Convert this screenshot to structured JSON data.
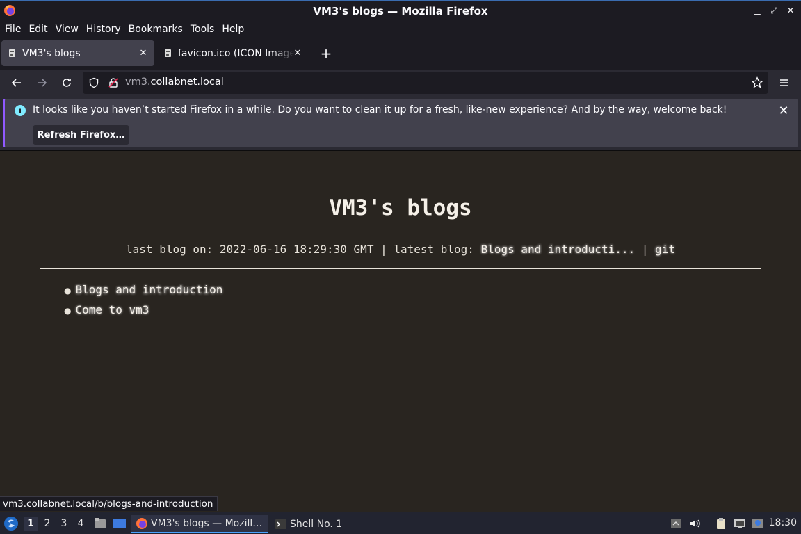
{
  "window": {
    "title": "VM3's blogs — Mozilla Firefox"
  },
  "menubar": {
    "items": [
      "File",
      "Edit",
      "View",
      "History",
      "Bookmarks",
      "Tools",
      "Help"
    ]
  },
  "tabs": [
    {
      "label": "VM3's blogs",
      "active": true
    },
    {
      "label": "favicon.ico (ICON Image,",
      "active": false
    }
  ],
  "urlbar": {
    "host_prefix": "vm3.",
    "host_rest": "collabnet.local"
  },
  "notification": {
    "message": "It looks like you haven’t started Firefox in a while. Do you want to clean it up for a fresh, like-new experience? And by the way, welcome back!",
    "button_label": "Refresh Firefox…"
  },
  "page": {
    "heading": "VM3's blogs",
    "meta_prefix": "last blog on: 2022-06-16 18:29:30 GMT | latest blog: ",
    "latest_blog_link": "Blogs and introducti...",
    "meta_separator": " | ",
    "git_link": "git",
    "posts": [
      "Blogs and introduction",
      "Come to vm3"
    ]
  },
  "status_link": "vm3.collabnet.local/b/blogs-and-introduction",
  "taskbar": {
    "workspaces": [
      "1",
      "2",
      "3",
      "4"
    ],
    "tasks": [
      "VM3's blogs — Mozill…",
      "Shell No. 1"
    ],
    "clock": "18:30"
  },
  "icons": {
    "app": "firefox-logo-icon",
    "tab_favicon": "favicon-icon",
    "back": "back-arrow-icon",
    "forward": "forward-arrow-icon",
    "reload": "reload-icon",
    "tracking": "shield-icon",
    "security": "lock-icon",
    "bookmark": "star-icon",
    "menu": "hamburger-menu-icon",
    "info": "info-icon"
  },
  "colors": {
    "chrome_dark": "#1c1b22",
    "toolbar": "#2b2a33",
    "notification": "#42414d",
    "page_bg": "#292520",
    "accent": "#9059ff"
  }
}
